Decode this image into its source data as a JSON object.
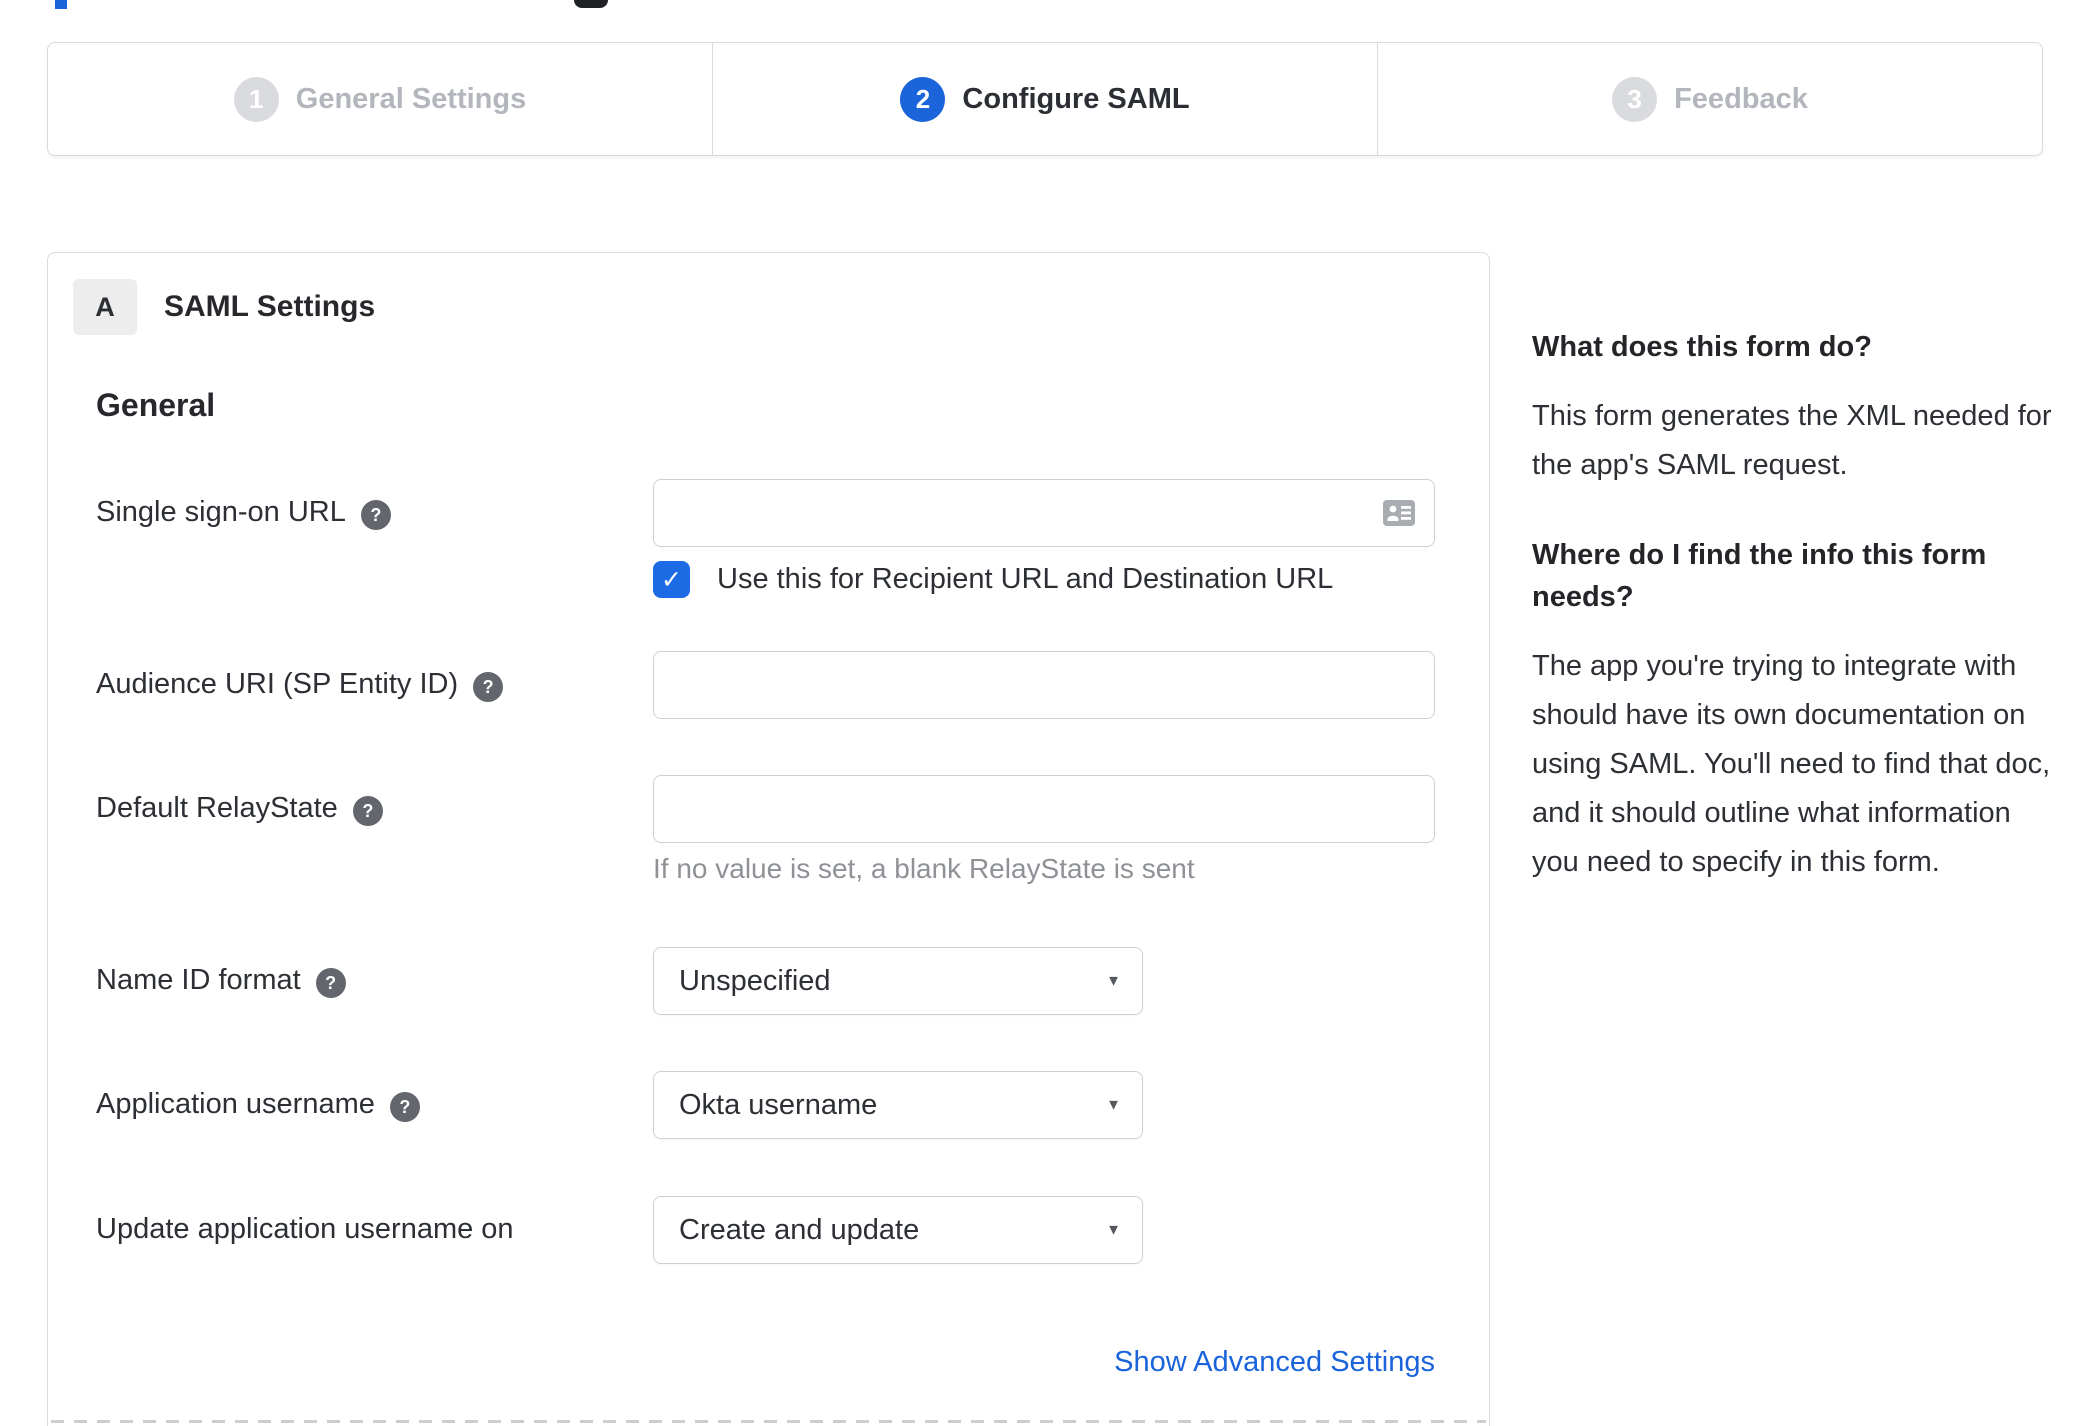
{
  "colors": {
    "accent_blue": "#1b64da",
    "checkbox_blue": "#1d6be4",
    "link_blue": "#1a63da",
    "inactive_circle_gray": "#d9dbde",
    "inactive_text_gray": "#b3b6bc",
    "helper_text_gray": "#8e9196"
  },
  "icons": {
    "help_glyph": "?",
    "caret": "▼",
    "checkmark": "✓"
  },
  "stepper": {
    "steps": [
      {
        "number": "1",
        "label": "General Settings",
        "state": "inactive"
      },
      {
        "number": "2",
        "label": "Configure SAML",
        "state": "active"
      },
      {
        "number": "3",
        "label": "Feedback",
        "state": "inactive"
      }
    ]
  },
  "panel": {
    "badge": "A",
    "title": "SAML Settings",
    "section_heading": "General",
    "rows": {
      "sso": {
        "label": "Single sign-on URL",
        "value": "",
        "has_help": true
      },
      "sso_checkbox": {
        "label": "Use this for Recipient URL and Destination URL",
        "checked": "true"
      },
      "audience": {
        "label": "Audience URI (SP Entity ID)",
        "value": "",
        "has_help": true
      },
      "relay": {
        "label": "Default RelayState",
        "value": "",
        "has_help": true,
        "helper_text": "If no value is set, a blank RelayState is sent"
      },
      "name_id": {
        "label": "Name ID format",
        "value": "Unspecified",
        "has_help": true
      },
      "app_username": {
        "label": "Application username",
        "value": "Okta username",
        "has_help": true
      },
      "update_username": {
        "label": "Update application username on",
        "value": "Create and update",
        "has_help": false
      }
    },
    "advanced_link": "Show Advanced Settings"
  },
  "help_sidebar": {
    "sections": [
      {
        "heading": "What does this form do?",
        "body": "This form generates the XML needed for the app's SAML request."
      },
      {
        "heading": "Where do I find the info this form needs?",
        "body": "The app you're trying to integrate with should have its own documentation on using SAML. You'll need to find that doc, and it should outline what information you need to specify in this form."
      }
    ]
  }
}
